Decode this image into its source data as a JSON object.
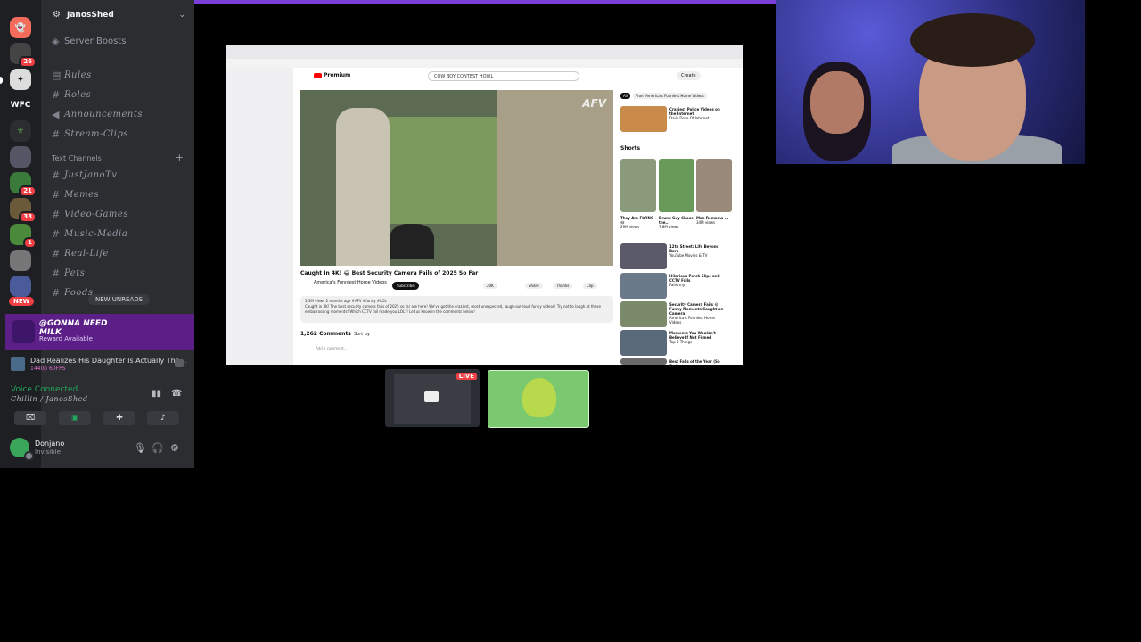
{
  "server": {
    "name": "JanosShed",
    "boosts": "Server Boosts",
    "rail_labels": {
      "wfc": "WFC",
      "new": "NEW"
    },
    "badges": [
      "26",
      "21",
      "33",
      "1"
    ]
  },
  "channels": {
    "top": [
      "Rules",
      "Roles",
      "Announcements",
      "Stream-Clips"
    ],
    "category": "Text Channels",
    "text": [
      "JustJanoTv",
      "Memes",
      "Video-Games",
      "Music-Media",
      "Real-Life",
      "Pets",
      "Foods"
    ],
    "new_unreads": "NEW UNREADS"
  },
  "promo": {
    "title": "@GONNA NEED MILK",
    "subtitle": "Reward Available"
  },
  "activity": {
    "title": "Dad Realizes His Daughter Is Actually The...",
    "meta": "1440p 60FPS"
  },
  "voice": {
    "status": "Voice Connected",
    "channel": "Chillin / JanosShed"
  },
  "user": {
    "name": "Donjano",
    "status": "Invisible"
  },
  "browser": {
    "search": "COW BOY CONTEST HOWL",
    "logo": "Premium",
    "create": "Create",
    "watermark": "AFV",
    "video_title": "Caught In 4K! 😂 Best Security Camera Fails of 2025 So Far",
    "channel": "America's Funniest Home Videos",
    "subscribe": "Subscribe",
    "actions": [
      "20K",
      "Share",
      "Thanks",
      "Clip"
    ],
    "desc_line1": "3.5M views  2 months ago  #AFV #funny #LOL",
    "desc_line2": "Caught in 4K! The best security camera fails of 2025 so far are here! We've got the craziest, most unexpected, laugh-out-loud funny videos! Try not to laugh at these embarrassing moments! Which CCTV fail made you LOL?! Let us know in the comments below!",
    "comments": "1,262 Comments",
    "sort": "Sort by",
    "add_comment": "Add a comment...",
    "chips": [
      "All",
      "From America's Funniest Home Videos"
    ],
    "recs": [
      {
        "title": "Craziest Police Videos on the Internet",
        "meta": "Daily Dose Of Internet"
      },
      {
        "title": "12th Street: Life Beyond Bars",
        "meta": "YouTube Movies & TV"
      },
      {
        "title": "Hilarious Porch Slips and CCTV Fails",
        "meta": "FailArmy"
      },
      {
        "title": "Security Camera Fails 😂 Funny Moments Caught on Camera",
        "meta": "America's Funniest Home Videos"
      },
      {
        "title": "Moments You Wouldn't Believe If Not Filmed",
        "meta": "Top 5 Things"
      },
      {
        "title": "Best Fails of the Year (So Far)",
        "meta": ""
      }
    ],
    "shorts_label": "Shorts",
    "shorts": [
      {
        "title": "They Are FLYING 😂",
        "views": "29M views"
      },
      {
        "title": "Drunk Guy Chose the...",
        "views": "7.8M views"
      },
      {
        "title": "Man Remains ...",
        "views": "34M views"
      }
    ]
  },
  "stream": {
    "live": "LIVE"
  },
  "colors": {
    "accent": "#7b3fd6",
    "voice_green": "#23a55a",
    "live_red": "#ed4245"
  }
}
